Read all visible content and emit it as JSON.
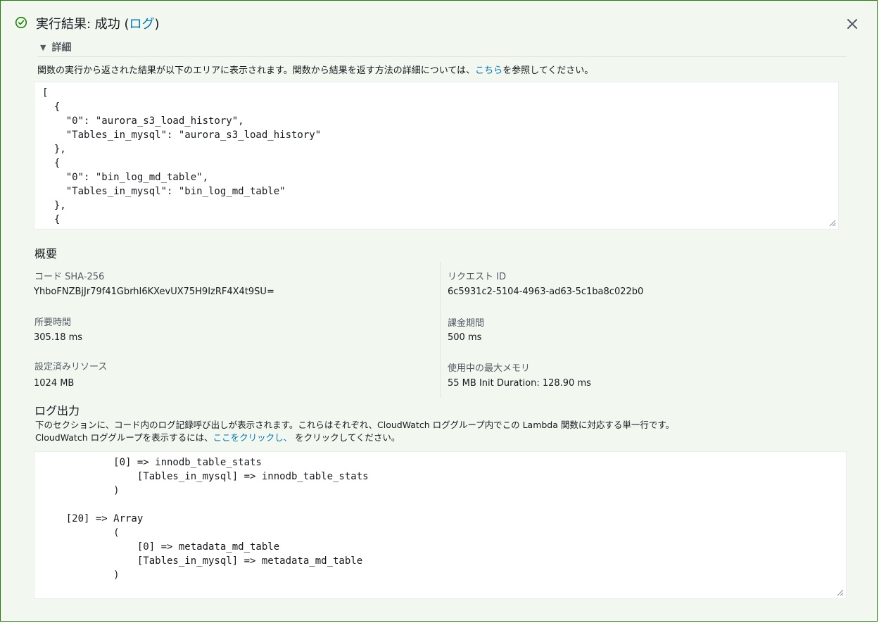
{
  "header": {
    "title_prefix": "実行結果: 成功 (",
    "title_link": "ログ",
    "title_suffix": ")"
  },
  "details": {
    "toggle_label": "詳細",
    "description_prefix": "関数の実行から返された結果が以下のエリアに表示されます。関数から結果を返す方法の詳細については、",
    "description_link": "こちら",
    "description_suffix": "を参照してください。",
    "result_text": "[\n  {\n    \"0\": \"aurora_s3_load_history\",\n    \"Tables_in_mysql\": \"aurora_s3_load_history\"\n  },\n  {\n    \"0\": \"bin_log_md_table\",\n    \"Tables_in_mysql\": \"bin_log_md_table\"\n  },\n  {"
  },
  "summary": {
    "title": "概要",
    "code_sha_label": "コード SHA-256",
    "code_sha_value": "YhboFNZBjJr79f41GbrhI6KXevUX75H9IzRF4X4t9SU=",
    "request_id_label": "リクエスト ID",
    "request_id_value": "6c5931c2-5104-4963-ad63-5c1ba8c022b0",
    "duration_label": "所要時間",
    "duration_value": "305.18 ms",
    "billed_duration_label": "課金期間",
    "billed_duration_value": "500 ms",
    "resources_label": "設定済みリソース",
    "resources_value": "1024 MB",
    "max_memory_label": "使用中の最大メモリ",
    "max_memory_value": "55 MB Init Duration: 128.90 ms"
  },
  "log": {
    "title": "ログ出力",
    "description_line1": "下のセクションに、コード内のログ記録呼び出しが表示されます。これらはそれぞれ、CloudWatch ロググループ内でこの Lambda 関数に対応する単一行です。",
    "description_line2_prefix": "CloudWatch ロググループを表示するには、",
    "description_line2_link": "ここをクリックし、",
    "description_line2_suffix": " をクリックしてください。",
    "log_text": "            [0] => innodb_table_stats\n                [Tables_in_mysql] => innodb_table_stats\n            )\n\n    [20] => Array\n            (\n                [0] => metadata_md_table\n                [Tables_in_mysql] => metadata_md_table\n            )"
  },
  "colors": {
    "success": "#1d8102",
    "link": "#0073bb",
    "panel_bg": "#f2f8f0"
  },
  "icons": {
    "status": "check-circle-icon",
    "close": "close-icon",
    "expand": "caret-down-icon",
    "resize": "resize-grip-icon"
  }
}
